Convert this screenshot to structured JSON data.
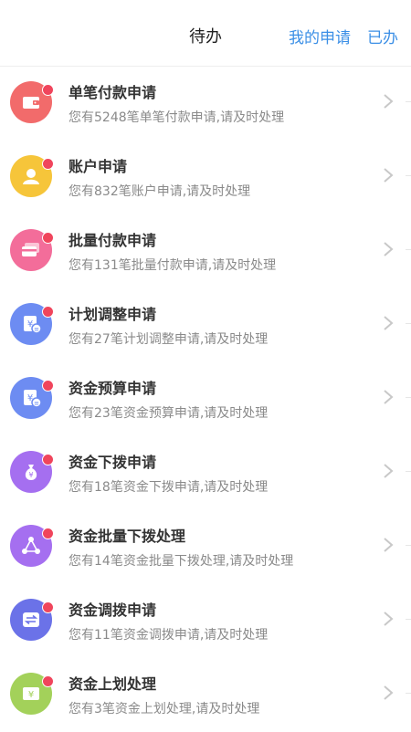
{
  "header": {
    "title": "待办",
    "my_apply": "我的申请",
    "done": "已办"
  },
  "items": [
    {
      "title": "单笔付款申请",
      "subtitle": "您有5248笔单笔付款申请,请及时处理",
      "icon": "wallet-icon",
      "color": "#f26b6b"
    },
    {
      "title": "账户申请",
      "subtitle": "您有832笔账户申请,请及时处理",
      "icon": "user-icon",
      "color": "#f6c53a"
    },
    {
      "title": "批量付款申请",
      "subtitle": "您有131笔批量付款申请,请及时处理",
      "icon": "cards-icon",
      "color": "#f36d9a"
    },
    {
      "title": "计划调整申请",
      "subtitle": "您有27笔计划调整申请,请及时处理",
      "icon": "yen-document-icon",
      "color": "#6d8cf2"
    },
    {
      "title": "资金预算申请",
      "subtitle": "您有23笔资金预算申请,请及时处理",
      "icon": "yen-document-icon",
      "color": "#6d8cf2"
    },
    {
      "title": "资金下拨申请",
      "subtitle": "您有18笔资金下拨申请,请及时处理",
      "icon": "money-bag-icon",
      "color": "#a56ff0"
    },
    {
      "title": "资金批量下拨处理",
      "subtitle": "您有14笔资金批量下拨处理,请及时处理",
      "icon": "network-icon",
      "color": "#a56ff0"
    },
    {
      "title": "资金调拨申请",
      "subtitle": "您有11笔资金调拨申请,请及时处理",
      "icon": "transfer-icon",
      "color": "#6b72e8"
    },
    {
      "title": "资金上划处理",
      "subtitle": "您有3笔资金上划处理,请及时处理",
      "icon": "yen-card-icon",
      "color": "#a3d15a"
    }
  ]
}
